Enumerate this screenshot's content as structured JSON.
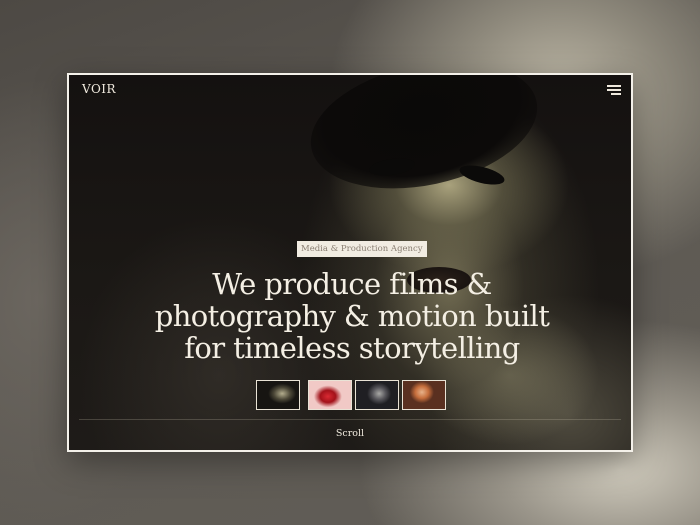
{
  "site": {
    "logo": "VOIR",
    "menu_icon": "hamburger-menu-icon"
  },
  "hero": {
    "tag": "Media & Production Agency",
    "headline_lines": [
      "We produce films &",
      "photography & motion built",
      "for timeless storytelling"
    ],
    "thumbnails": [
      "portrait-thumbnail",
      "red-product-thumbnail",
      "monochrome-portrait-thumbnail",
      "warm-portrait-thumbnail"
    ],
    "scroll_label": "Scroll"
  },
  "colors": {
    "text": "#f4efe4",
    "frame_border": "#f4f1ea",
    "tag_bg": "#f1ece2",
    "tag_text": "#8a7f73"
  }
}
